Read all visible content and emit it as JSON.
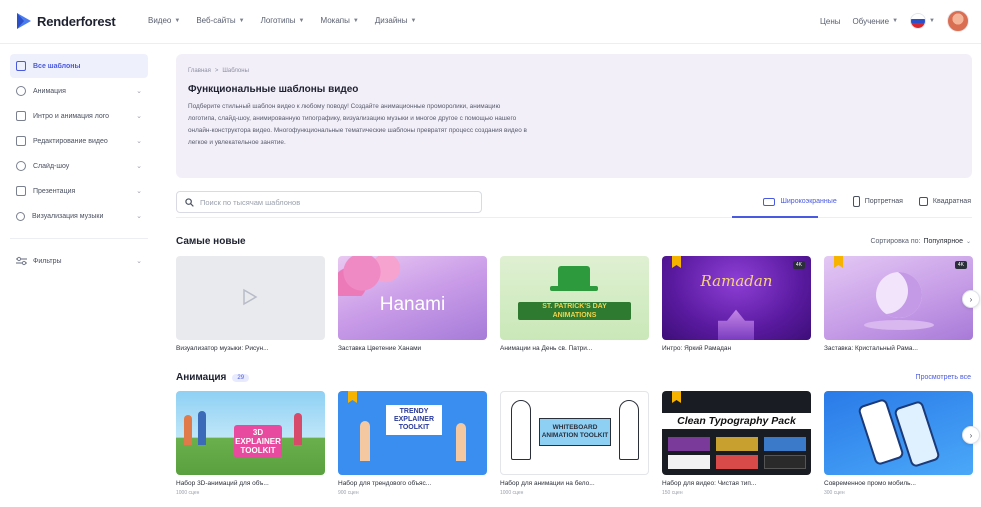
{
  "brand": {
    "name": "Renderforest"
  },
  "nav": [
    {
      "label": "Видео"
    },
    {
      "label": "Веб-сайты"
    },
    {
      "label": "Логотипы"
    },
    {
      "label": "Мокапы"
    },
    {
      "label": "Дизайны"
    }
  ],
  "header_right": {
    "pricing": "Цены",
    "learning": "Обучение"
  },
  "sidebar": {
    "items": [
      {
        "label": "Все шаблоны"
      },
      {
        "label": "Анимация"
      },
      {
        "label": "Интро и анимация лого"
      },
      {
        "label": "Редактирование видео"
      },
      {
        "label": "Слайд-шоу"
      },
      {
        "label": "Презентация"
      },
      {
        "label": "Визуализация музыки"
      }
    ],
    "filters": "Фильтры"
  },
  "hero": {
    "crumbs": [
      "Главная",
      ">",
      "Шаблоны"
    ],
    "title": "Функциональные шаблоны видео",
    "description": "Подберите стильный шаблон видео к любому поводу! Создайте анимационные проморолики, анимацию логотипа, слайд-шоу, анимированную типографику, визуализацию музыки и многое другое с помощью нашего онлайн-конструктора видео. Многофункциональные тематические шаблоны превратят процесс создания видео в легкое и увлекательное занятие."
  },
  "search": {
    "placeholder": "Поиск по тысячам шаблонов"
  },
  "orientation": {
    "wide": "Широкоэкранные",
    "portrait": "Портретная",
    "square": "Квадратная"
  },
  "newest": {
    "title": "Самые новые",
    "sort_label": "Сортировка по:",
    "sort_value": "Популярное",
    "cards": [
      {
        "label": "Визуализатор музыки: Рисун...",
        "thumb_text": ""
      },
      {
        "label": "Заставка Цветение Ханами",
        "thumb_text": "Hanami"
      },
      {
        "label": "Анимации на День св. Патри...",
        "thumb_text": "ST. PATRICK'S DAY ANIMATIONS"
      },
      {
        "label": "Интро: Яркий Рамадан",
        "thumb_text": "Ramadan",
        "badge": "4K"
      },
      {
        "label": "Заставка: Кристальный Рама...",
        "thumb_text": "",
        "badge": "4K"
      }
    ]
  },
  "animation": {
    "title": "Анимация",
    "count": "29",
    "see_all": "Просмотреть все",
    "cards": [
      {
        "label": "Набор 3D-анимаций для объ...",
        "sub": "1000 сцен",
        "thumb_text": "3D EXPLAINER TOOLKIT"
      },
      {
        "label": "Набор для трендового объяс...",
        "sub": "900 сцен",
        "thumb_text": "TRENDY EXPLAINER TOOLKIT"
      },
      {
        "label": "Набор для анимации на бело...",
        "sub": "1000 сцен",
        "thumb_text": "WHITEBOARD ANIMATION TOOLKIT"
      },
      {
        "label": "Набор для видео: Чистая тип...",
        "sub": "150 сцен",
        "thumb_text": "Clean Typography Pack"
      },
      {
        "label": "Современное промо мобиль...",
        "sub": "300 сцен",
        "thumb_text": ""
      }
    ]
  }
}
